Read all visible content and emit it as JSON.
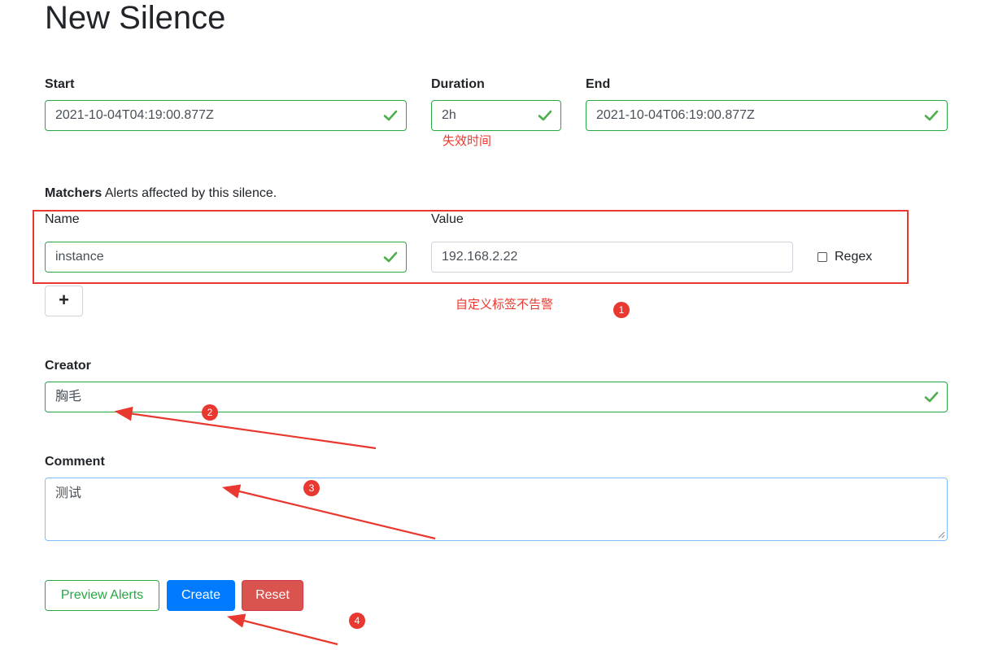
{
  "page": {
    "title": "New Silence"
  },
  "form": {
    "start": {
      "label": "Start",
      "value": "2021-10-04T04:19:00.877Z"
    },
    "duration": {
      "label": "Duration",
      "value": "2h"
    },
    "end": {
      "label": "End",
      "value": "2021-10-04T06:19:00.877Z"
    },
    "matchers": {
      "title": "Matchers",
      "subtitle": "Alerts affected by this silence.",
      "name_label": "Name",
      "value_label": "Value",
      "name_value": "instance",
      "value_value": "192.168.2.22",
      "regex_label": "Regex",
      "regex_checked": false,
      "add_label": "+"
    },
    "creator": {
      "label": "Creator",
      "value": "胸毛"
    },
    "comment": {
      "label": "Comment",
      "value": "测试"
    }
  },
  "buttons": {
    "preview": "Preview Alerts",
    "create": "Create",
    "reset": "Reset"
  },
  "annotations": {
    "duration_note": "失效时间",
    "matcher_note": "自定义标签不告警",
    "badges": [
      "1",
      "2",
      "3",
      "4"
    ],
    "color": "#e8382f"
  },
  "colors": {
    "valid": "#28a745",
    "primary": "#007bff",
    "danger": "#d9534f"
  },
  "icons": {
    "valid_check": "check-icon"
  }
}
